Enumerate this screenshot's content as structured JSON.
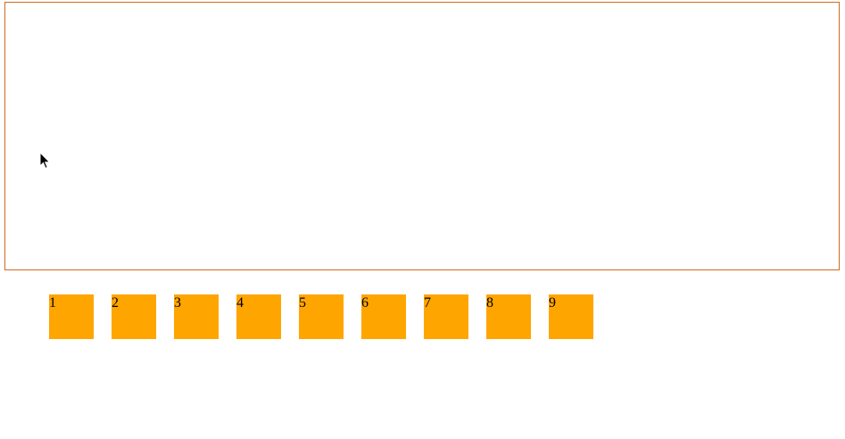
{
  "colors": {
    "tile": "#ffa500",
    "drop_zone_border": "#d2691e",
    "background": "#ffffff"
  },
  "drop_zone": {
    "icon": "mouse-pointer-icon"
  },
  "tiles": [
    {
      "label": "1"
    },
    {
      "label": "2"
    },
    {
      "label": "3"
    },
    {
      "label": "4"
    },
    {
      "label": "5"
    },
    {
      "label": "6"
    },
    {
      "label": "7"
    },
    {
      "label": "8"
    },
    {
      "label": "9"
    }
  ]
}
